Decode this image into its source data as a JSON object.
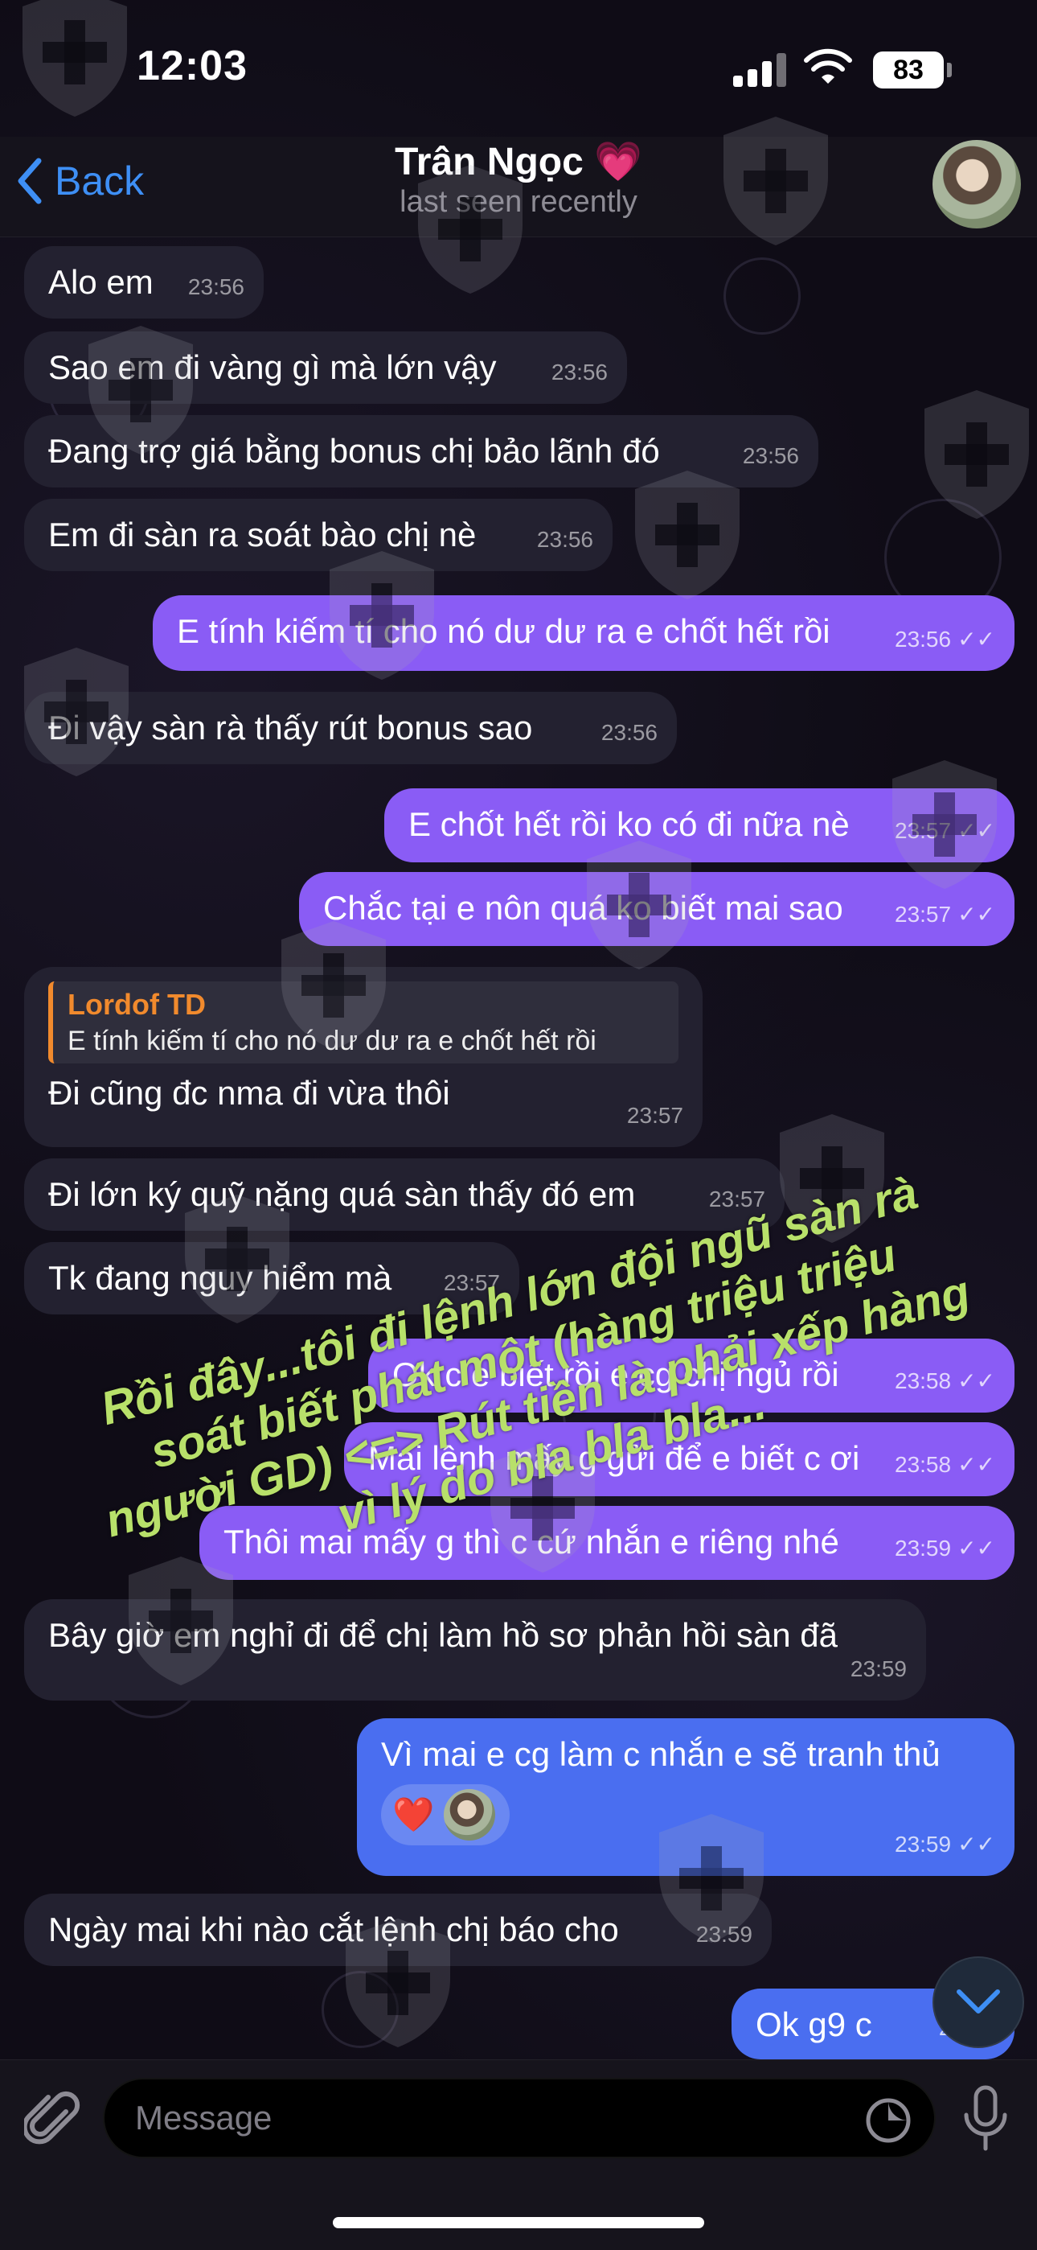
{
  "status_bar": {
    "time": "12:03",
    "battery": "83"
  },
  "header": {
    "back_label": "Back",
    "contact_name": "Trân Ngọc",
    "name_emoji": "💗",
    "contact_status": "last seen recently"
  },
  "messages": [
    {
      "dir": "in",
      "text": "Alo em",
      "time": "23:56"
    },
    {
      "dir": "in",
      "text": "Sao em đi vàng gì mà lớn vậy",
      "time": "23:56"
    },
    {
      "dir": "in",
      "text": "Đang trợ giá bằng bonus chị bảo lãnh đó",
      "time": "23:56"
    },
    {
      "dir": "in",
      "text": "Em đi sàn ra soát bào chị nè",
      "time": "23:56"
    },
    {
      "dir": "out",
      "text": "E tính kiếm tí cho nó dư dư ra e chốt hết rồi",
      "time": "23:56"
    },
    {
      "dir": "in",
      "text": "Đi vậy sàn rà thấy rút bonus sao",
      "time": "23:56"
    },
    {
      "dir": "out",
      "text": "E chốt hết rồi ko có đi nữa nè",
      "time": "23:57"
    },
    {
      "dir": "out",
      "text": "Chắc tại e nôn quá ko biết mai sao",
      "time": "23:57"
    },
    {
      "dir": "in",
      "reply_name": "Lordof TD",
      "reply_text": "E tính kiếm tí cho nó dư dư ra e chốt hết rồi",
      "text": "Đi cũng đc nma đi vừa thôi",
      "time": "23:57"
    },
    {
      "dir": "in",
      "text": "Đi lớn ký quỹ nặng quá sàn thấy đó em",
      "time": "23:57"
    },
    {
      "dir": "in",
      "text": "Tk đang nguy hiểm mà",
      "time": "23:57"
    },
    {
      "dir": "out",
      "text": "Ok c e biết rồi e cg chị ngủ rồi",
      "time": "23:58"
    },
    {
      "dir": "out",
      "text": "Mai lệnh mấy g gửi để e biết c ơi",
      "time": "23:58"
    },
    {
      "dir": "out",
      "text": "Thôi mai mấy g thì c cứ nhắn e riêng nhé",
      "time": "23:59"
    },
    {
      "dir": "in",
      "text": "Bây giờ em nghỉ đi để chị làm hồ sơ phản hồi sàn đã",
      "time": "23:59"
    },
    {
      "dir": "out",
      "text": "Vì mai e cg làm c nhắn e sẽ tranh thủ",
      "time": "23:59",
      "reaction": "❤️"
    },
    {
      "dir": "in",
      "text": "Ngày mai khi nào cắt lệnh chị báo cho",
      "time": "23:59"
    },
    {
      "dir": "out",
      "text": "Ok g9 c",
      "time": "23:59"
    }
  ],
  "annotation": "Rồi đây...tôi đi lệnh lớn đội ngũ sàn rà soát biết phát một (hàng triệu triệu người GD) <=> Rút tiền là phải xếp hàng vì lý do bla bla bla...",
  "input": {
    "placeholder": "Message"
  },
  "colors": {
    "outgoing": "#8a5cf5",
    "incoming": "#232130",
    "accent": "#3e8ff5",
    "reply_accent": "#f18a2d",
    "annotation": "#b8e06a"
  },
  "icons": [
    "chevron-left-icon",
    "signal-icon",
    "wifi-icon",
    "battery-icon",
    "paperclip-icon",
    "sticker-icon",
    "microphone-icon",
    "chevron-down-icon",
    "double-check-icon",
    "shield-watermark-icon"
  ]
}
